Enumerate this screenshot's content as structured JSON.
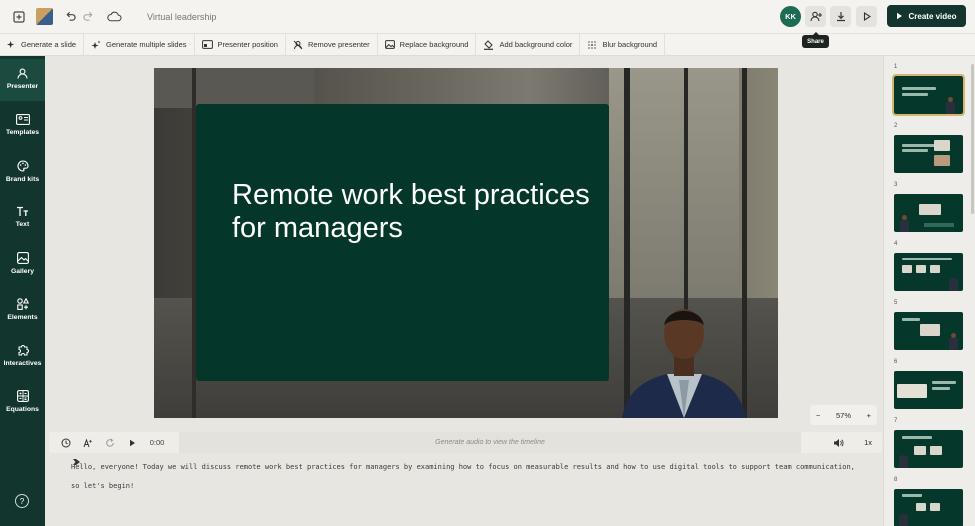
{
  "topbar": {
    "doc_title": "Virtual leadership",
    "avatar_initials": "KK",
    "create_label": "Create video",
    "share_tooltip": "Share"
  },
  "toolbar": {
    "tools": [
      {
        "label": "Generate a slide",
        "icon": "sparkle-icon"
      },
      {
        "label": "Generate multiple slides",
        "icon": "sparkles-icon"
      },
      {
        "label": "Presenter position",
        "icon": "presenter-position-icon"
      },
      {
        "label": "Remove presenter",
        "icon": "remove-presenter-icon"
      },
      {
        "label": "Replace background",
        "icon": "image-icon"
      },
      {
        "label": "Add background color",
        "icon": "paint-bucket-icon"
      },
      {
        "label": "Blur background",
        "icon": "blur-icon"
      }
    ]
  },
  "sidebar": {
    "items": [
      {
        "label": "Presenter",
        "icon": "presenter-icon"
      },
      {
        "label": "Templates",
        "icon": "templates-icon"
      },
      {
        "label": "Brand kits",
        "icon": "palette-icon"
      },
      {
        "label": "Text",
        "icon": "text-icon"
      },
      {
        "label": "Gallery",
        "icon": "gallery-icon"
      },
      {
        "label": "Elements",
        "icon": "elements-icon"
      },
      {
        "label": "Interactives",
        "icon": "puzzle-icon"
      },
      {
        "label": "Equations",
        "icon": "equations-icon"
      }
    ],
    "help_glyph": "?"
  },
  "slide": {
    "title": "Remote work best practices for managers"
  },
  "zoom": {
    "minus": "−",
    "value": "57%",
    "plus": "+"
  },
  "timeline": {
    "time": "0:00",
    "placeholder": "Generate audio to view the timeline",
    "speed": "1x"
  },
  "script": {
    "text": "Hello, everyone! Today we will discuss remote work best practices for managers by examining how to focus on measurable results and how to use digital tools to support team communication, so let's begin!"
  },
  "thumbnails": {
    "numbers": [
      "1",
      "2",
      "3",
      "4",
      "5",
      "6",
      "7",
      "8"
    ],
    "selected_index": 1
  },
  "colors": {
    "brand_dark": "#12362e",
    "slide_panel": "#04372a",
    "avatar": "#1d6a55",
    "selected_outline": "#d6b56c"
  }
}
